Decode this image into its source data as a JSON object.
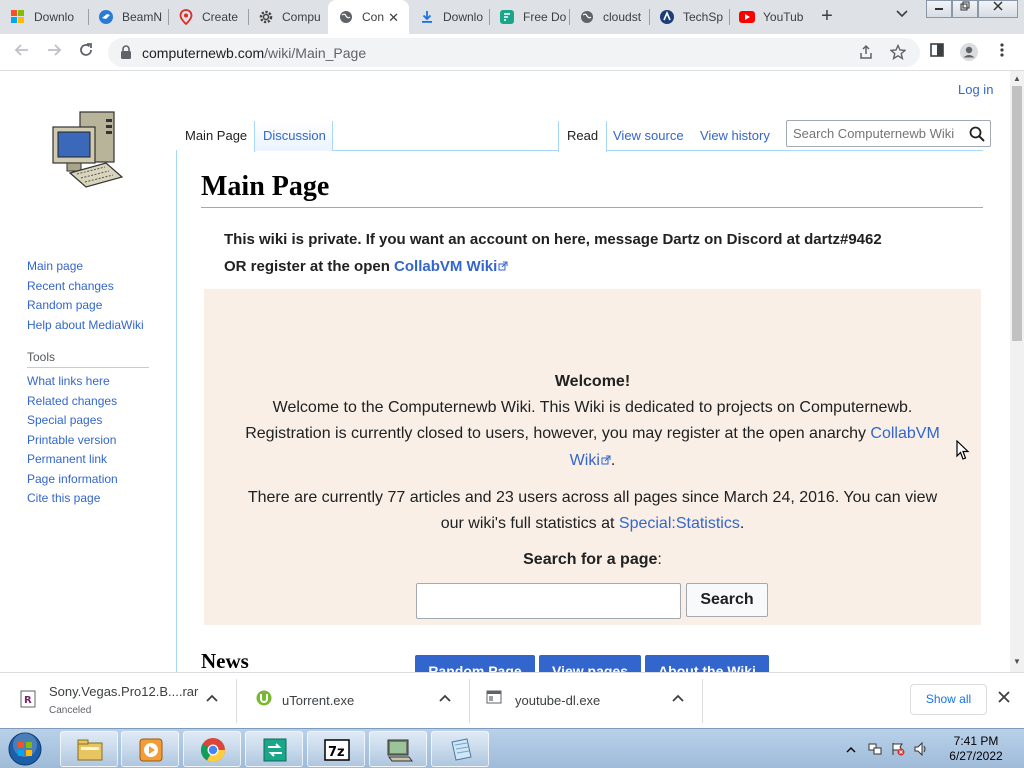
{
  "browser": {
    "tabs": [
      {
        "label": "Downlo",
        "icon": "windows-icon"
      },
      {
        "label": "BeamN",
        "icon": "beamng-icon"
      },
      {
        "label": "Create",
        "icon": "map-pin-icon"
      },
      {
        "label": "Compu",
        "icon": "gear-icon"
      },
      {
        "label": "Con",
        "icon": "globe-icon",
        "active": true
      },
      {
        "label": "Downlo",
        "icon": "download-icon"
      },
      {
        "label": "Free Do",
        "icon": "freedo-icon"
      },
      {
        "label": "cloudst",
        "icon": "globe-icon"
      },
      {
        "label": "TechSp",
        "icon": "techspot-icon"
      },
      {
        "label": "YouTub",
        "icon": "youtube-icon"
      }
    ],
    "url_host": "computernewb.com",
    "url_path": "/wiki/Main_Page"
  },
  "wiki": {
    "login": "Log in",
    "page_tabs": {
      "main": "Main Page",
      "discussion": "Discussion",
      "read": "Read",
      "view_source": "View source",
      "view_history": "View history"
    },
    "search_placeholder": "Search Computernewb Wiki",
    "sidebar_nav": [
      "Main page",
      "Recent changes",
      "Random page",
      "Help about MediaWiki"
    ],
    "tools_heading": "Tools",
    "tools": [
      "What links here",
      "Related changes",
      "Special pages",
      "Printable version",
      "Permanent link",
      "Page information",
      "Cite this page"
    ],
    "title": "Main Page",
    "notice_line1": "This wiki is private. If you want an account on here, message Dartz on Discord at dartz#9462",
    "notice_line2_prefix": "OR register at the open ",
    "notice_link": "CollabVM Wiki",
    "welcome": {
      "heading": "Welcome!",
      "line1": "Welcome to the Computernewb Wiki. This Wiki is dedicated to projects on Computernewb.",
      "line2_prefix": "Registration is currently closed to users, however, you may register at the open anarchy ",
      "link_part1": "CollabVM",
      "link_part2": "Wiki",
      "line2_suffix": ".",
      "stats_line1": "There are currently 77 articles and 23 users across all pages since March 24, 2016. You can view",
      "stats_line2_prefix": "our wiki's full statistics at ",
      "stats_link": "Special:Statistics",
      "stats_suffix": ".",
      "search_label": "Search for a page",
      "search_colon": ":",
      "search_button": "Search",
      "buttons": [
        "Random Page",
        "View pages",
        "About the Wiki"
      ]
    },
    "news_heading": "News"
  },
  "downloads": [
    {
      "name": "Sony.Vegas.Pro12.B....rar",
      "status": "Canceled"
    },
    {
      "name": "uTorrent.exe",
      "status": ""
    },
    {
      "name": "youtube-dl.exe",
      "status": ""
    }
  ],
  "downloads_show_all": "Show all",
  "taskbar": {
    "time": "7:41 PM",
    "date": "6/27/2022",
    "apps": [
      "explorer-icon",
      "media-player-icon",
      "chrome-icon",
      "transfer-icon",
      "7zip-icon",
      "computer-icon",
      "notepad-icon"
    ]
  },
  "colors": {
    "link": "#3366cc",
    "welcome_bg": "#f9efe6",
    "button_blue": "#3366cc",
    "tab_strip": "#dee1e6"
  }
}
